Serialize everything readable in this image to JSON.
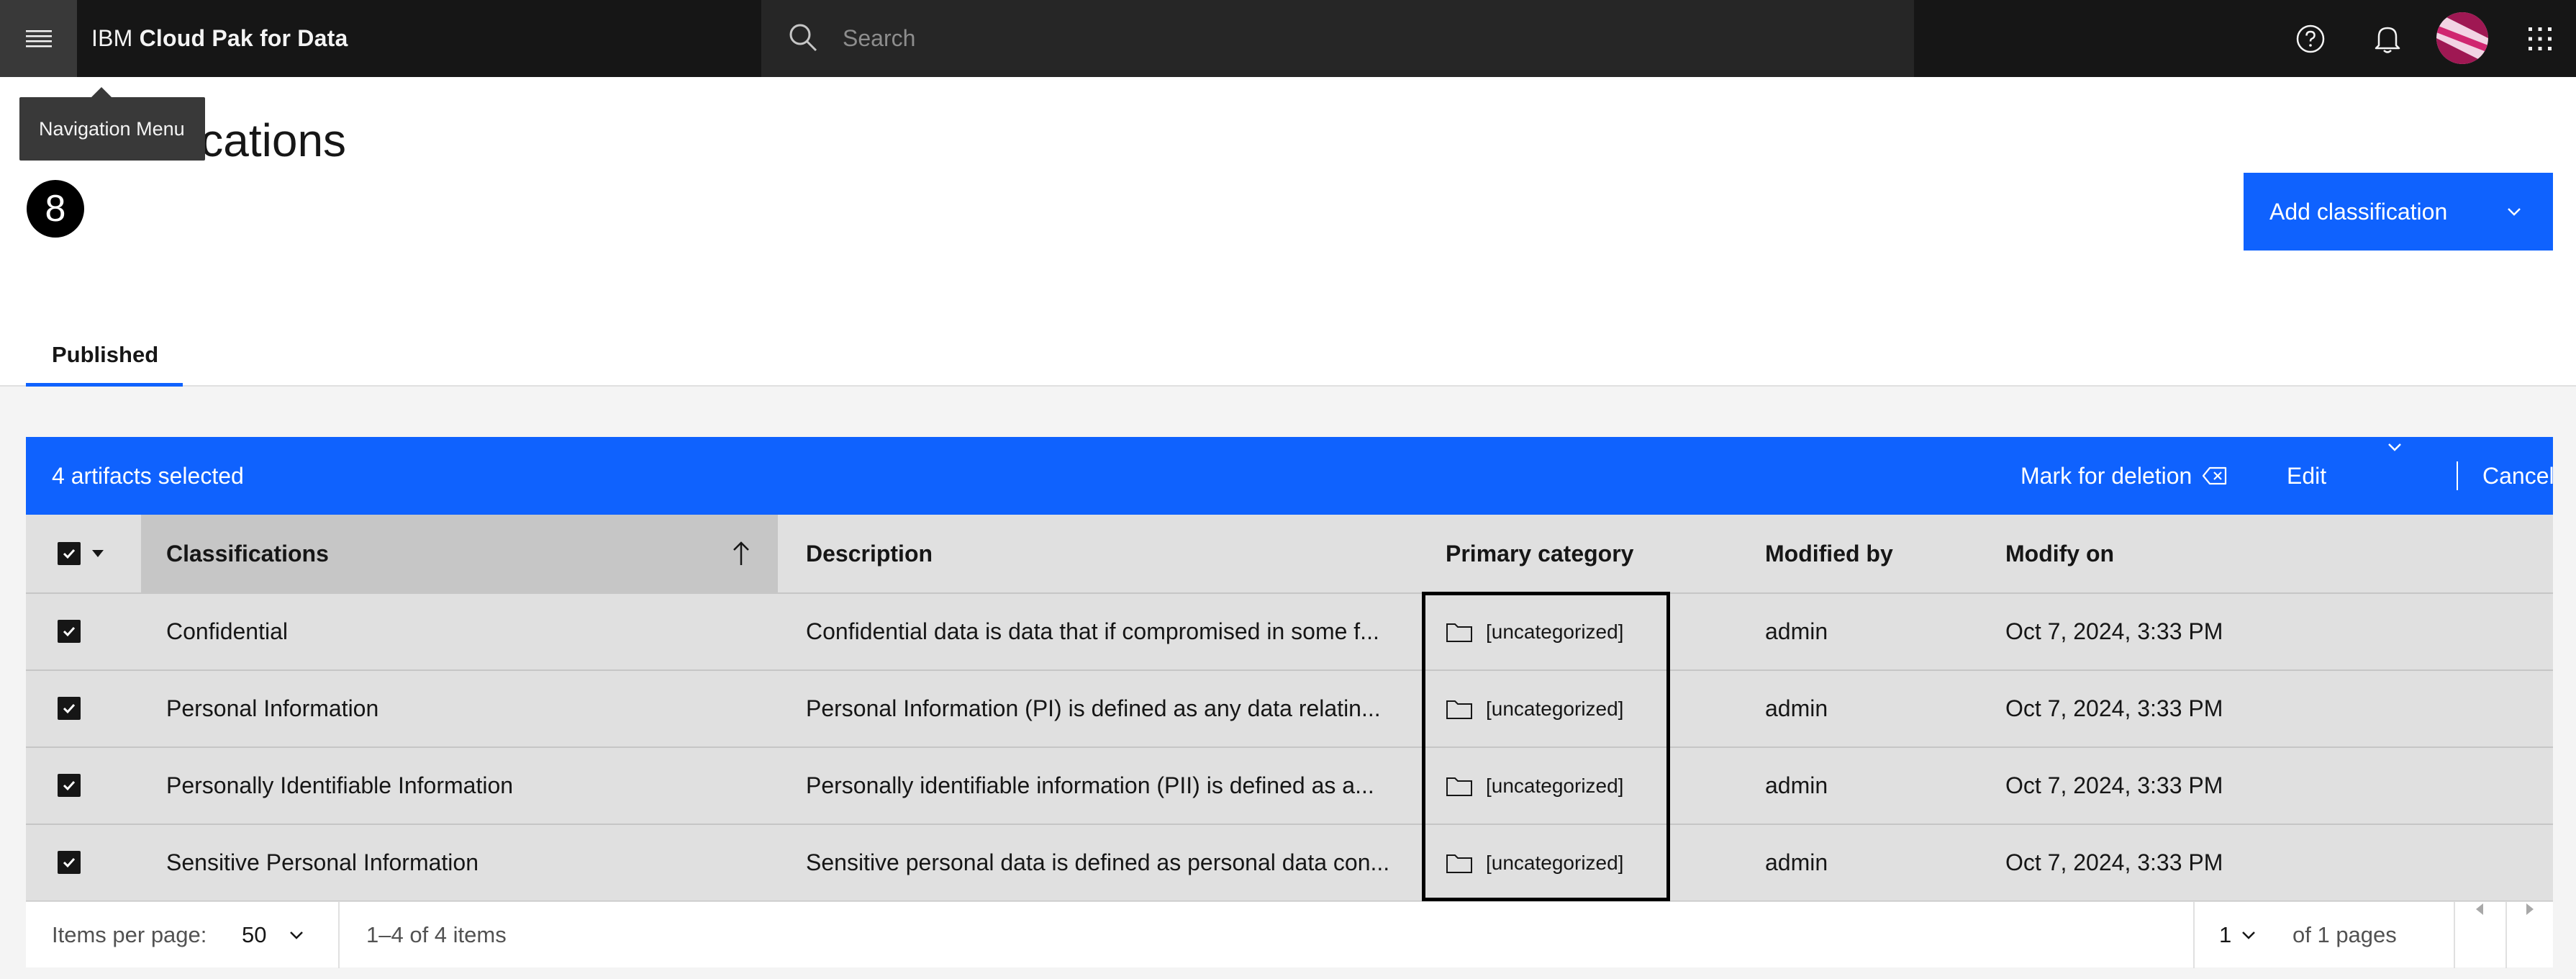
{
  "header": {
    "brand_prefix": "IBM",
    "brand_name": "Cloud Pak for Data",
    "search_placeholder": "Search",
    "menu_tooltip": "Navigation Menu"
  },
  "page": {
    "title": "Classifications",
    "step_badge": "8",
    "add_button_label": "Add classification"
  },
  "tabs": [
    {
      "label": "Published",
      "active": true
    }
  ],
  "batch_bar": {
    "selected_text": "4 artifacts selected",
    "mark_for_deletion_label": "Mark for deletion",
    "edit_label": "Edit",
    "cancel_label": "Cancel"
  },
  "table": {
    "columns": [
      "Classifications",
      "Description",
      "Primary category",
      "Modified by",
      "Modify on"
    ],
    "rows": [
      {
        "name": "Confidential",
        "description": "Confidential data is data that if compromised in some f...",
        "category": "[uncategorized]",
        "modified_by": "admin",
        "modified_on": "Oct 7, 2024, 3:33 PM",
        "checked": true
      },
      {
        "name": "Personal Information",
        "description": "Personal Information (PI) is defined as any data relatin...",
        "category": "[uncategorized]",
        "modified_by": "admin",
        "modified_on": "Oct 7, 2024, 3:33 PM",
        "checked": true
      },
      {
        "name": "Personally Identifiable Information",
        "description": "Personally identifiable information (PII) is defined as a...",
        "category": "[uncategorized]",
        "modified_by": "admin",
        "modified_on": "Oct 7, 2024, 3:33 PM",
        "checked": true
      },
      {
        "name": "Sensitive Personal Information",
        "description": "Sensitive personal data is defined as personal data con...",
        "category": "[uncategorized]",
        "modified_by": "admin",
        "modified_on": "Oct 7, 2024, 3:33 PM",
        "checked": true
      }
    ]
  },
  "pagination": {
    "items_per_page_label": "Items per page:",
    "items_per_page_value": "50",
    "range_text": "1–4 of 4 items",
    "page_value": "1",
    "of_pages_text": "of 1 pages"
  },
  "colors": {
    "accent": "#0f62fe",
    "header_bg": "#161616"
  }
}
